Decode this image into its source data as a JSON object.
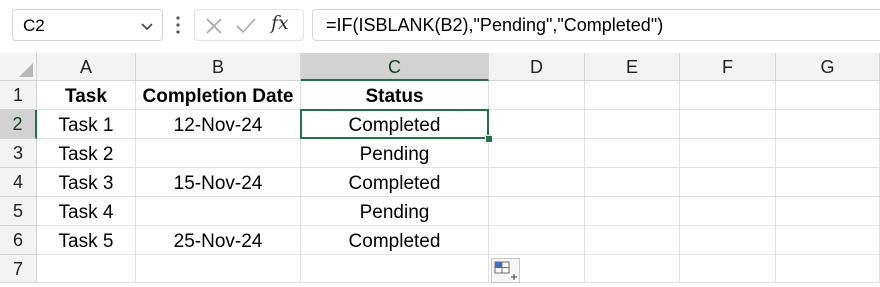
{
  "name_box": {
    "value": "C2"
  },
  "formula_bar": {
    "fx_label": "fx",
    "formula": "=IF(ISBLANK(B2),\"Pending\",\"Completed\")"
  },
  "columns": [
    "A",
    "B",
    "C",
    "D",
    "E",
    "F",
    "G"
  ],
  "rows": [
    "1",
    "2",
    "3",
    "4",
    "5",
    "6",
    "7"
  ],
  "selected_cell": "C2",
  "cells": [
    [
      "Task",
      "Completion Date",
      "Status",
      "",
      "",
      "",
      ""
    ],
    [
      "Task 1",
      "12-Nov-24",
      "Completed",
      "",
      "",
      "",
      ""
    ],
    [
      "Task 2",
      "",
      "Pending",
      "",
      "",
      "",
      ""
    ],
    [
      "Task 3",
      "15-Nov-24",
      "Completed",
      "",
      "",
      "",
      ""
    ],
    [
      "Task 4",
      "",
      "Pending",
      "",
      "",
      "",
      ""
    ],
    [
      "Task 5",
      "25-Nov-24",
      "Completed",
      "",
      "",
      "",
      ""
    ],
    [
      "",
      "",
      "",
      "",
      "",
      "",
      ""
    ]
  ],
  "icons": [
    "chevron-down-icon",
    "more-vertical-icon",
    "cancel-icon",
    "enter-check-icon",
    "insert-function-icon",
    "quick-analysis-icon"
  ],
  "colors": {
    "accent": "#217346",
    "header_bg": "#f3f3f3",
    "header_selected_bg": "#d2d2d2",
    "gridline": "#e1e1e1"
  }
}
